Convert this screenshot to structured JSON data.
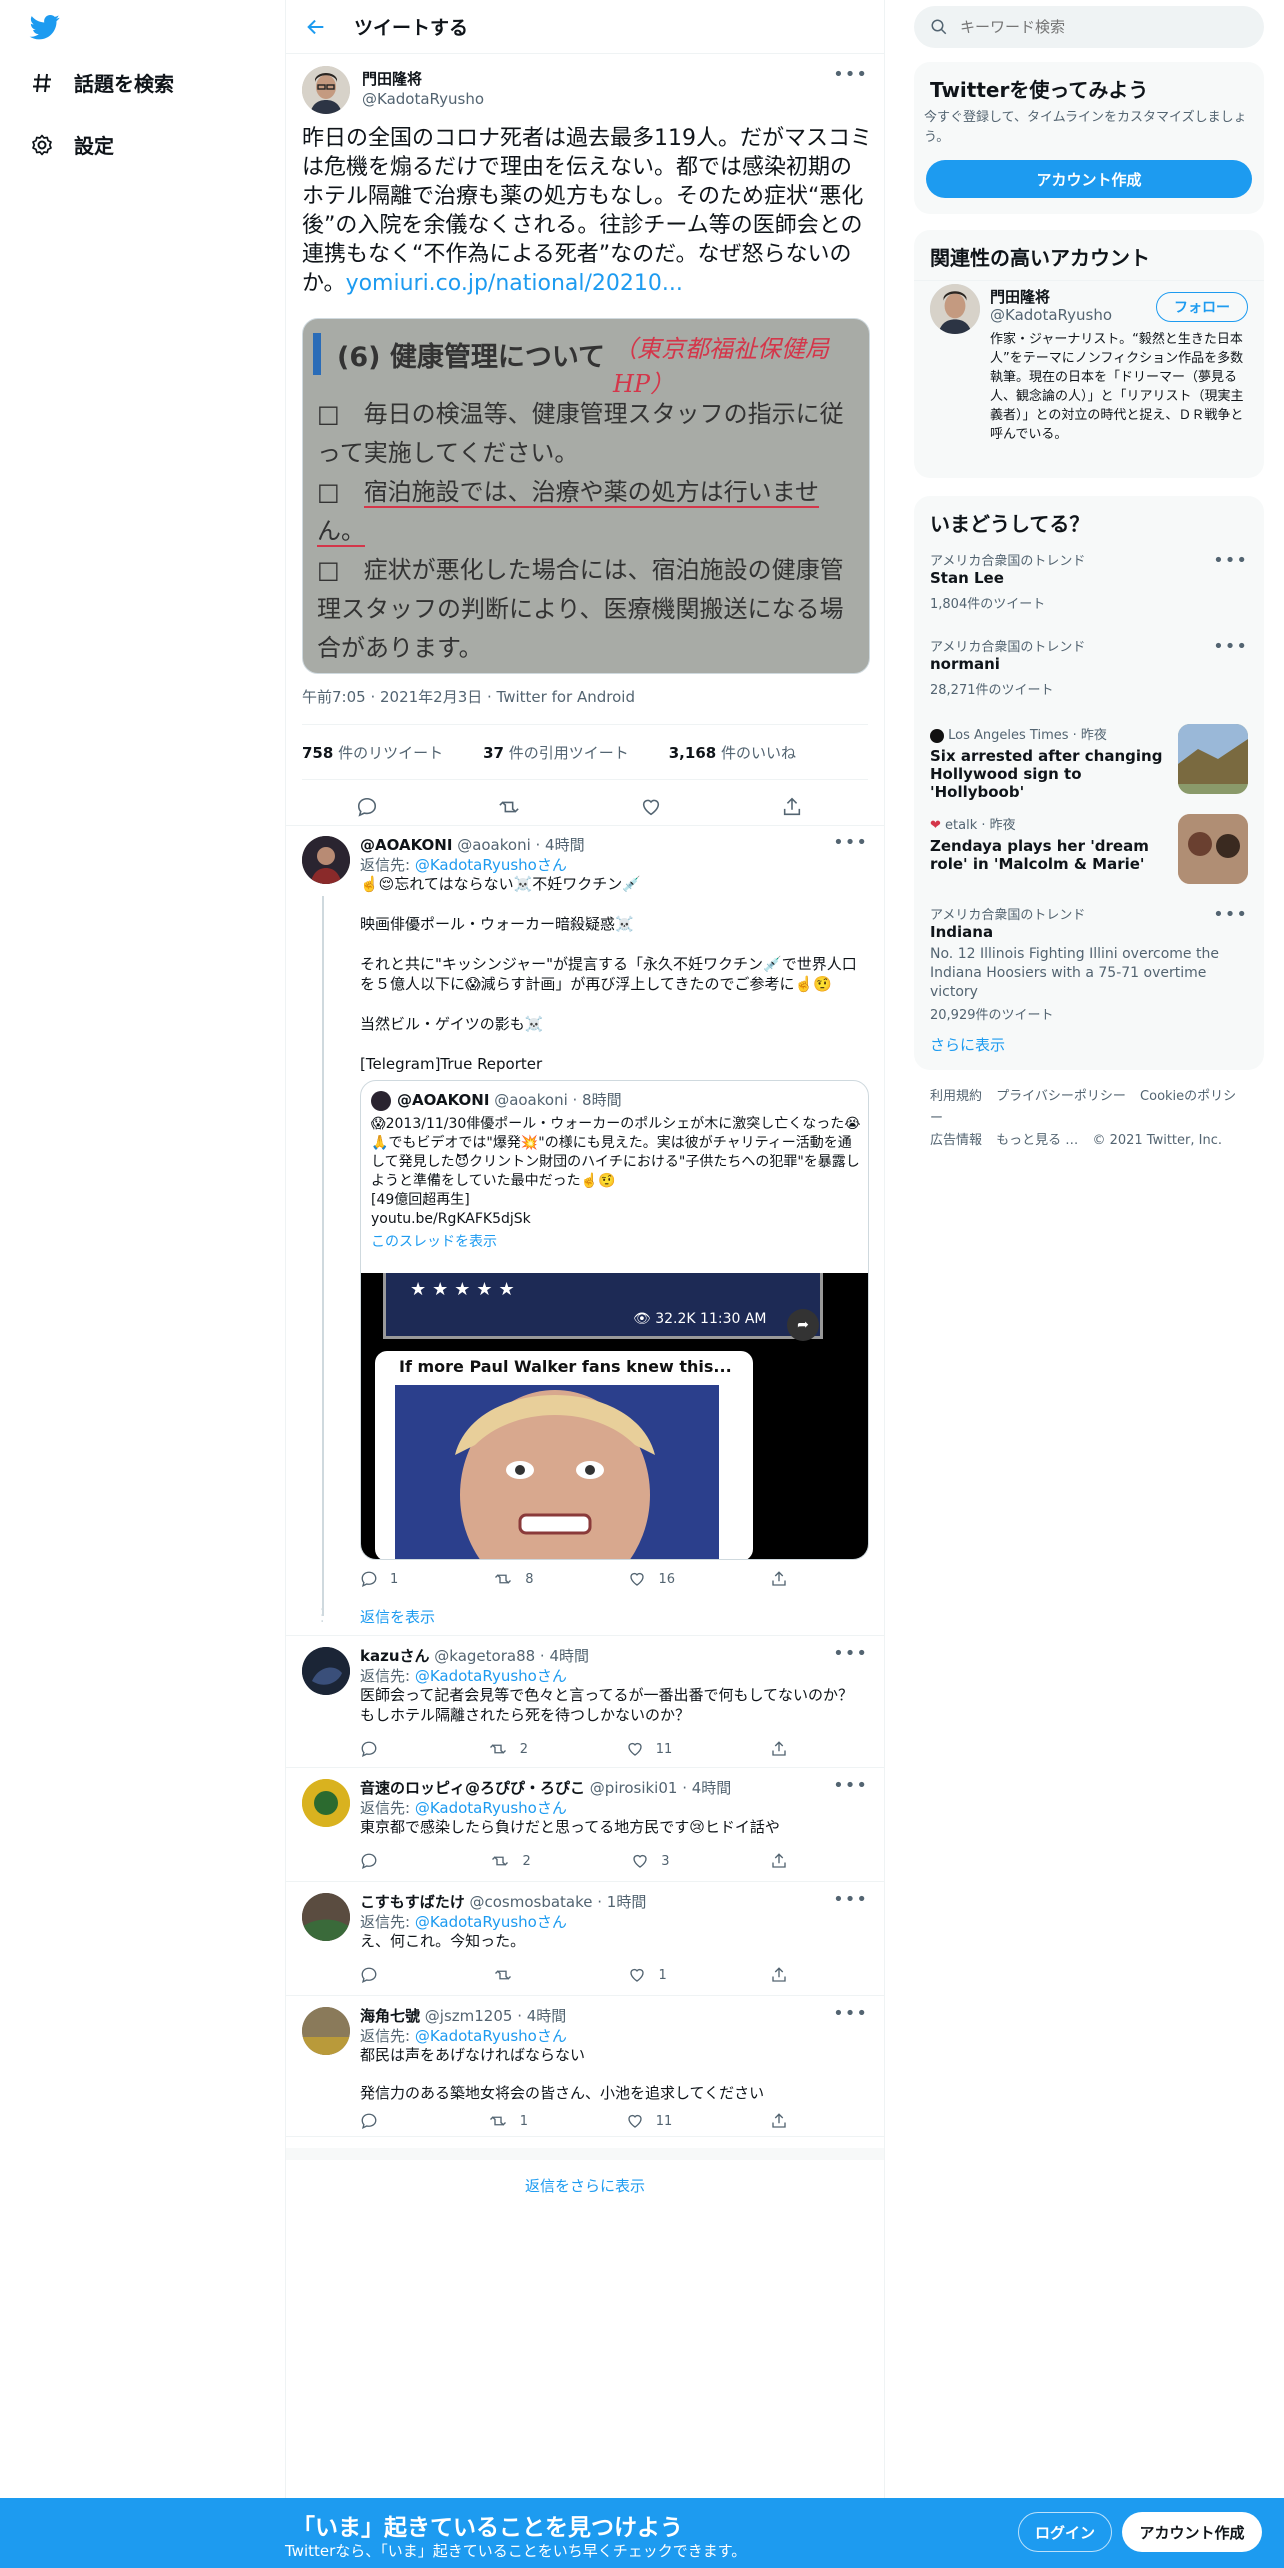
{
  "nav": {
    "explore": "話題を検索",
    "settings": "設定"
  },
  "header": {
    "title": "ツイートする"
  },
  "tweet": {
    "name": "門田隆将",
    "handle": "@KadotaRyusho",
    "text": "昨日の全国のコロナ死者は過去最多119人。だがマスコミは危機を煽るだけで理由を伝えない。都では感染初期のホテル隔離で治療も薬の処方もなし。そのため症状“悪化後”の入院を余儀なくされる。往診チーム等の医師会との連携もなく“不作為による死者”なのだ。なぜ怒らないのか。",
    "link": "yomiuri.co.jp/national/20210...",
    "image": {
      "heading": "(6) 健康管理について",
      "handwritten": "（東京都福祉保健局HP）",
      "line1": "□　毎日の検温等、健康管理スタッフの指示に従って実施してください。",
      "line2a": "□　",
      "line2b": "宿泊施設では、治療や薬の処方は行いません。",
      "line3": "□　症状が悪化した場合には、宿泊施設の健康管理スタッフの判断により、医療機関搬送になる場合があります。"
    },
    "time": "午前7:05 · 2021年2月3日 · Twitter for Android",
    "retweets_n": "758",
    "retweets_l": " 件のリツイート",
    "quotes_n": "37",
    "quotes_l": " 件の引用ツイート",
    "likes_n": "3,168",
    "likes_l": " 件のいいね"
  },
  "replyto_label": "返信先: ",
  "replyto_handle": "@KadotaRyusho",
  "replyto_suffix": "さん",
  "replies": [
    {
      "name": "@AOAKONI",
      "handle": "@aoakoni · 4時間",
      "lines": [
        "☝️😌忘れてはならない☠️不妊ワクチン💉",
        "映画俳優ポール・ウォーカー暗殺疑惑☠️",
        "それと共に\"キッシンジャー\"が提言する「永久不妊ワクチン💉で世界人口を５億人以下に😱減らす計画」が再び浮上してきたのでご参考に☝️🤨",
        "当然ビル・ゲイツの影も☠️",
        "[Telegram]True Reporter"
      ],
      "quote": {
        "name": "@AOAKONI",
        "handle": "@aoakoni · 8時間",
        "text": "😱2013/11/30俳優ポール・ウォーカーのポルシェが木に激突し亡くなった😭🙏でもビデオでは\"爆発💥\"の様にも見えた。実は彼がチャリティー活動を通して発見した😈クリントン財団のハイチにおける\"子供たちへの犯罪\"を暴露しようと準備をしていた最中だった☝️🤨",
        "views": "[49億回超再生]",
        "yt": "youtu.be/RgKAFK5djSk",
        "thread": "このスレッドを表示",
        "video_stat": "32.2K 11:30 AM",
        "video_caption": "If more Paul Walker fans knew this..."
      },
      "reply": "1",
      "rt": "8",
      "like": "16",
      "show_replies": "返信を表示"
    },
    {
      "name": "kazuさん",
      "handle": "@kagetora88 · 4時間",
      "text": "医師会って記者会見等で色々と言ってるが一番出番で何もしてないのか？もしホテル隔離されたら死を待つしかないのか？",
      "reply": "",
      "rt": "2",
      "like": "11"
    },
    {
      "name": "音速のロッピィ@ろぴぴ・ろぴこ",
      "handle": "@pirosiki01 · 4時間",
      "text": "東京都で感染したら負けだと思ってる地方民です😢ヒドイ話や",
      "reply": "",
      "rt": "2",
      "like": "3"
    },
    {
      "name": "こすもすばたけ",
      "handle": "@cosmosbatake · 1時間",
      "text": "え、何これ。今知った。",
      "reply": "",
      "rt": "",
      "like": "1"
    },
    {
      "name": "海角七號",
      "handle": "@jszm1205 · 4時間",
      "text1": "都民は声をあげなければならない",
      "text2": "発信力のある築地女将会の皆さん、小池を追求してください",
      "reply": "",
      "rt": "1",
      "like": "11"
    }
  ],
  "show_more_replies": "返信をさらに表示",
  "right": {
    "search_placeholder": "キーワード検索",
    "signup_title": "Twitterを使ってみよう",
    "signup_desc": "今すぐ登録して、タイムラインをカスタマイズしましょう。",
    "signup_btn": "アカウント作成",
    "related_title": "関連性の高いアカウント",
    "related": {
      "name": "門田隆将",
      "handle": "@KadotaRyusho",
      "follow": "フォロー",
      "bio": "作家・ジャーナリスト。“毅然と生きた日本人”をテーマにノンフィクション作品を多数執筆。現在の日本を「ドリーマー（夢見る人、観念論の人）」と「リアリスト（現実主義者）」との対立の時代と捉え、ＤＲ戦争と呼んでいる。"
    },
    "trends_title": "いまどうしてる？",
    "trends": [
      {
        "ctx": "アメリカ合衆国のトレンド",
        "title": "Stan Lee",
        "count": "1,804件のツイート"
      },
      {
        "ctx": "アメリカ合衆国のトレンド",
        "title": "normani",
        "count": "28,271件のツイート"
      },
      {
        "ctx": "Los Angeles Times · 昨夜",
        "title": "Six arrested after changing Hollywood sign to 'Hollyboob'",
        "count": ""
      },
      {
        "ctx": "etalk · 昨夜",
        "title": "Zendaya plays her 'dream role' in 'Malcolm & Marie'",
        "count": ""
      },
      {
        "ctx": "アメリカ合衆国のトレンド",
        "title": "Indiana",
        "sub": "No. 12 Illinois Fighting Illini overcome the Indiana Hoosiers with a 75-71 overtime victory",
        "count": "20,929件のツイート"
      }
    ],
    "show_more": "さらに表示",
    "footer": [
      "利用規約",
      "プライバシーポリシー",
      "Cookieのポリシー",
      "広告情報",
      "もっと見る …",
      "© 2021 Twitter, Inc."
    ]
  },
  "bottom": {
    "title": "「いま」起きていることを見つけよう",
    "sub": "Twitterなら、「いま」起きていることをいち早くチェックできます。",
    "login": "ログイン",
    "signup": "アカウント作成"
  },
  "colors": {
    "accent": "#1d9bf0",
    "text": "#0f1419",
    "muted": "#536471"
  }
}
